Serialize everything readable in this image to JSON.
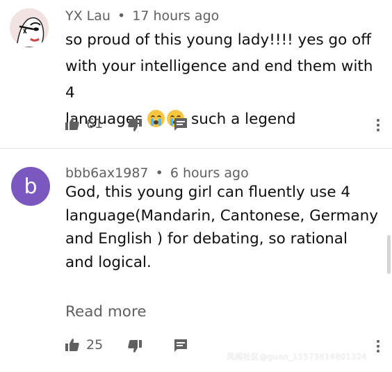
{
  "comments": [
    {
      "author": "YX Lau",
      "separator": "•",
      "time": "17 hours ago",
      "text_line1": "so proud of this young lady!!!! yes go off",
      "text_line2": "with your intelligence and end them with 4",
      "text_line3_start": "languages",
      "text_line3_end": "such a legend",
      "emoji": [
        "crying-face",
        "crying-face"
      ],
      "likes": "61"
    },
    {
      "author": "bbb6ax1987",
      "separator": "•",
      "time": "6 hours ago",
      "avatar_letter": "b",
      "avatar_color": "#7b58c0",
      "text": "God, this young girl can fluently use 4 language(Mandarin, Cantonese, Germany and English ) for debating, so rational and logical.",
      "read_more": "Read more",
      "likes": "25"
    }
  ],
  "icons": {
    "like": "thumbs-up-icon",
    "dislike": "thumbs-down-icon",
    "reply": "reply-comment-icon",
    "more": "more-vertical-icon"
  },
  "watermark": "风闻社区@guan_15573814801324"
}
